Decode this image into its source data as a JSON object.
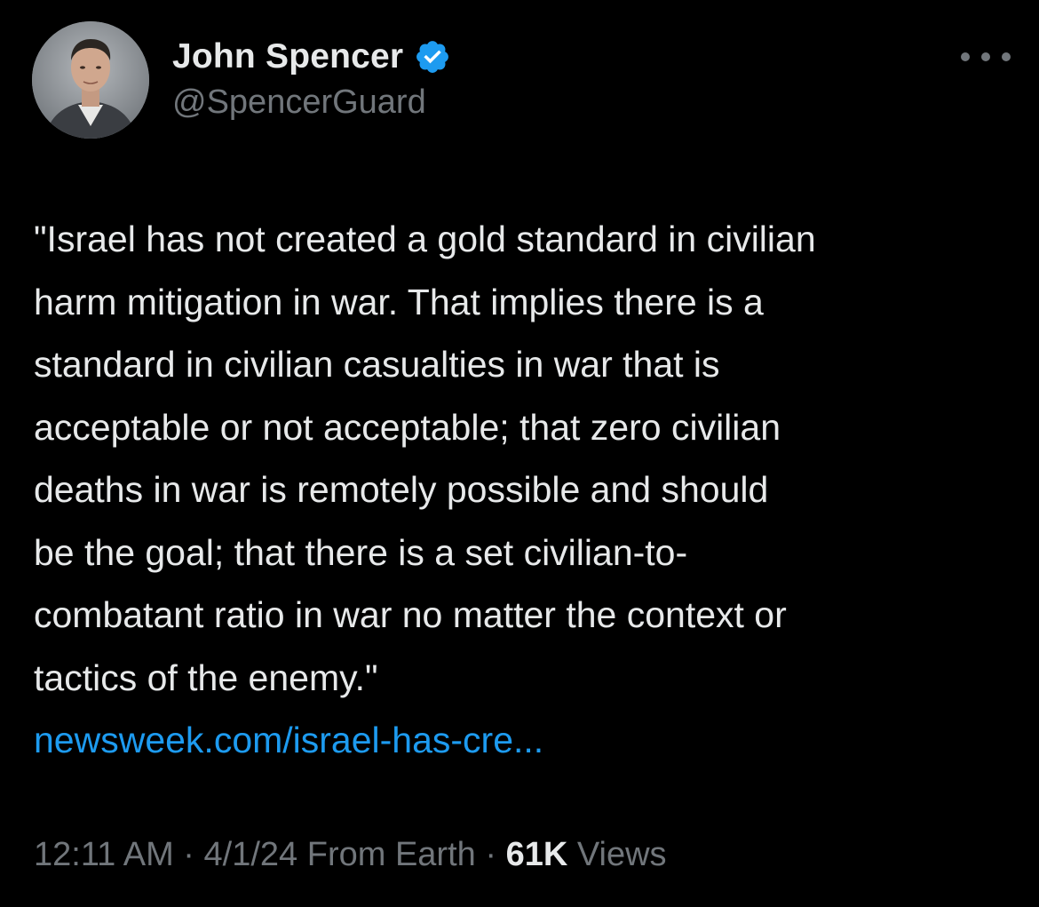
{
  "author": {
    "display_name": "John Spencer",
    "handle": "@SpencerGuard",
    "verified": true
  },
  "tweet": {
    "lines": [
      "\"Israel has not created a gold standard in civilian",
      "harm mitigation in war. That implies there is a",
      "standard in civilian casualties in war that is",
      "acceptable or not acceptable; that zero civilian",
      "deaths in war is remotely possible and should",
      "be the goal; that there is a set civilian-to-",
      "combatant ratio in war no matter the context or",
      "tactics of the enemy.\""
    ],
    "link": "newsweek.com/israel-has-cre..."
  },
  "meta": {
    "time": "12:11 AM",
    "sep1": "·",
    "date": "4/1/24",
    "source": "From Earth",
    "sep2": "·",
    "views_count": "61K",
    "views_label": "Views"
  },
  "colors": {
    "background": "#000000",
    "text": "#e7e9ea",
    "secondary": "#71767b",
    "link": "#1d9bf0",
    "verified_badge": "#1d9bf0"
  },
  "icons": {
    "verified": "verified-badge-icon",
    "more": "more-options-icon"
  }
}
